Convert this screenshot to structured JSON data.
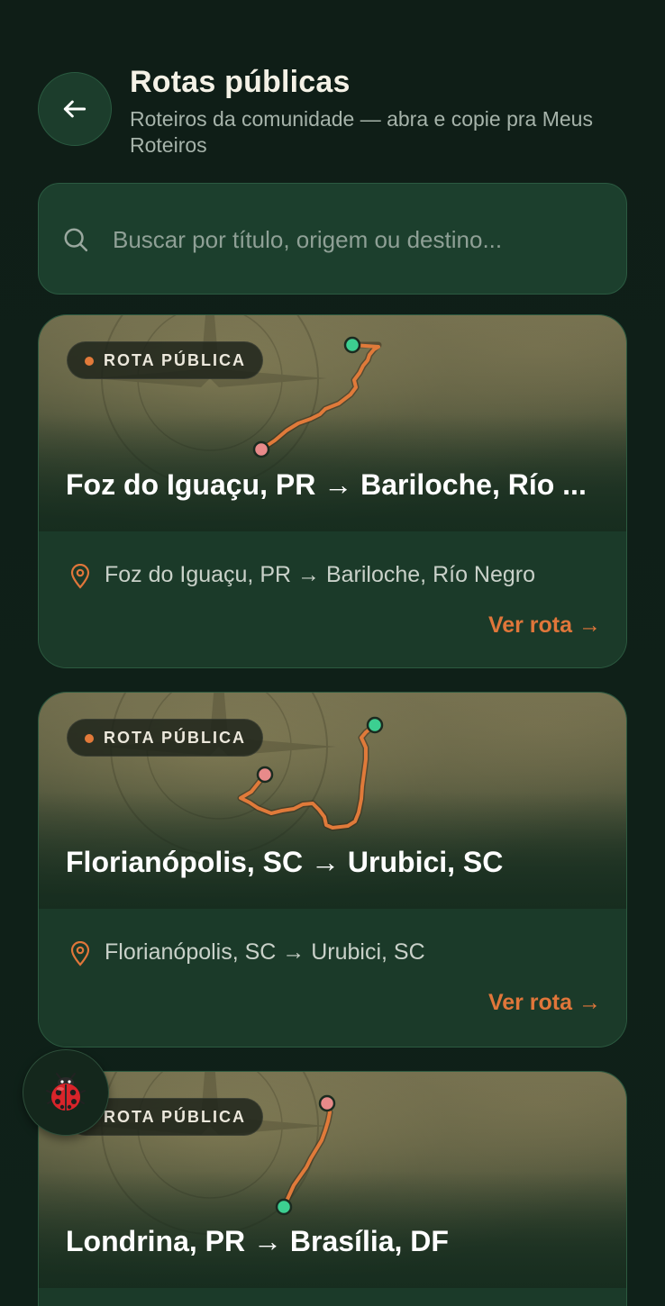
{
  "header": {
    "title": "Rotas públicas",
    "subtitle": "Roteiros da comunidade — abra e copie pra Meus Roteiros",
    "back_icon": "arrow-left-icon"
  },
  "search": {
    "placeholder": "Buscar por título, origem ou destino...",
    "value": "",
    "icon": "search-icon"
  },
  "cards": [
    {
      "badge": "ROTA PÚBLICA",
      "title": "Foz do Iguaçu, PR → Bariloche, Río ...",
      "route": "Foz do Iguaçu, PR → Bariloche, Río Negro",
      "action": "Ver rota →"
    },
    {
      "badge": "ROTA PÚBLICA",
      "title": "Florianópolis, SC → Urubici, SC",
      "route": "Florianópolis, SC → Urubici, SC",
      "action": "Ver rota →"
    },
    {
      "badge": "ROTA PÚBLICA",
      "title": "Londrina, PR → Brasília, DF",
      "route": "",
      "action": ""
    }
  ],
  "floating": {
    "icon": "ladybug-icon"
  },
  "colors": {
    "background": "#0f1f17",
    "card": "#1b3a29",
    "accent": "#e0763a",
    "route_line": "#e07a3a",
    "start_marker": "#3ccf91",
    "end_marker": "#e88a8a"
  }
}
